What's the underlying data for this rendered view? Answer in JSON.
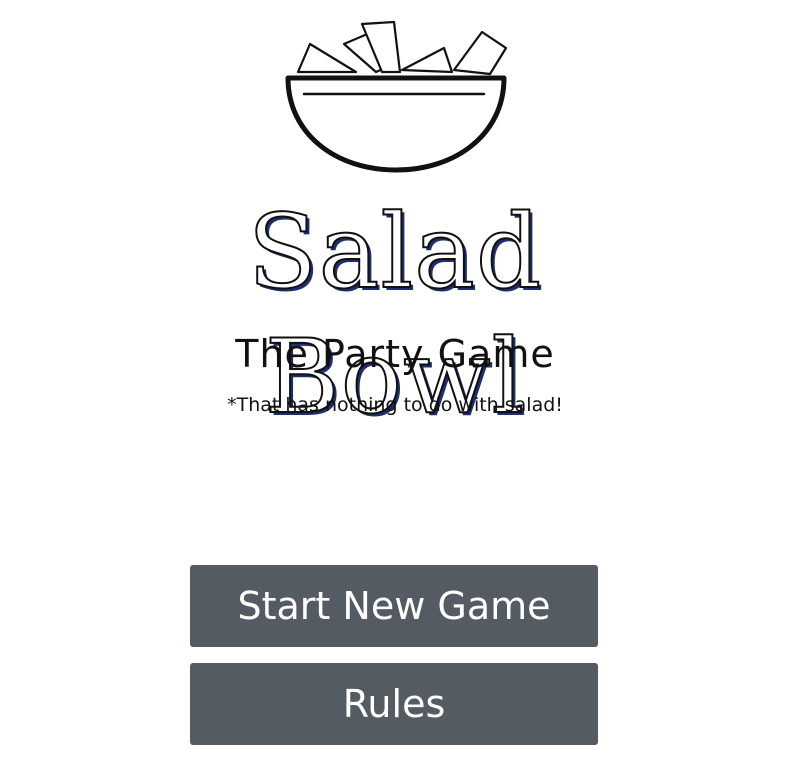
{
  "logo": {
    "icon": "salad-bowl-icon"
  },
  "title": "Salad Bowl",
  "subtitle": "The Party Game",
  "tagline": "*That has nothing to do with salad!",
  "buttons": {
    "start_new_game": "Start New Game",
    "rules": "Rules"
  },
  "colors": {
    "button_bg": "#555b62",
    "button_text": "#ffffff",
    "title_shadow": "#1f2e6e",
    "text": "#111111",
    "background": "#ffffff"
  }
}
